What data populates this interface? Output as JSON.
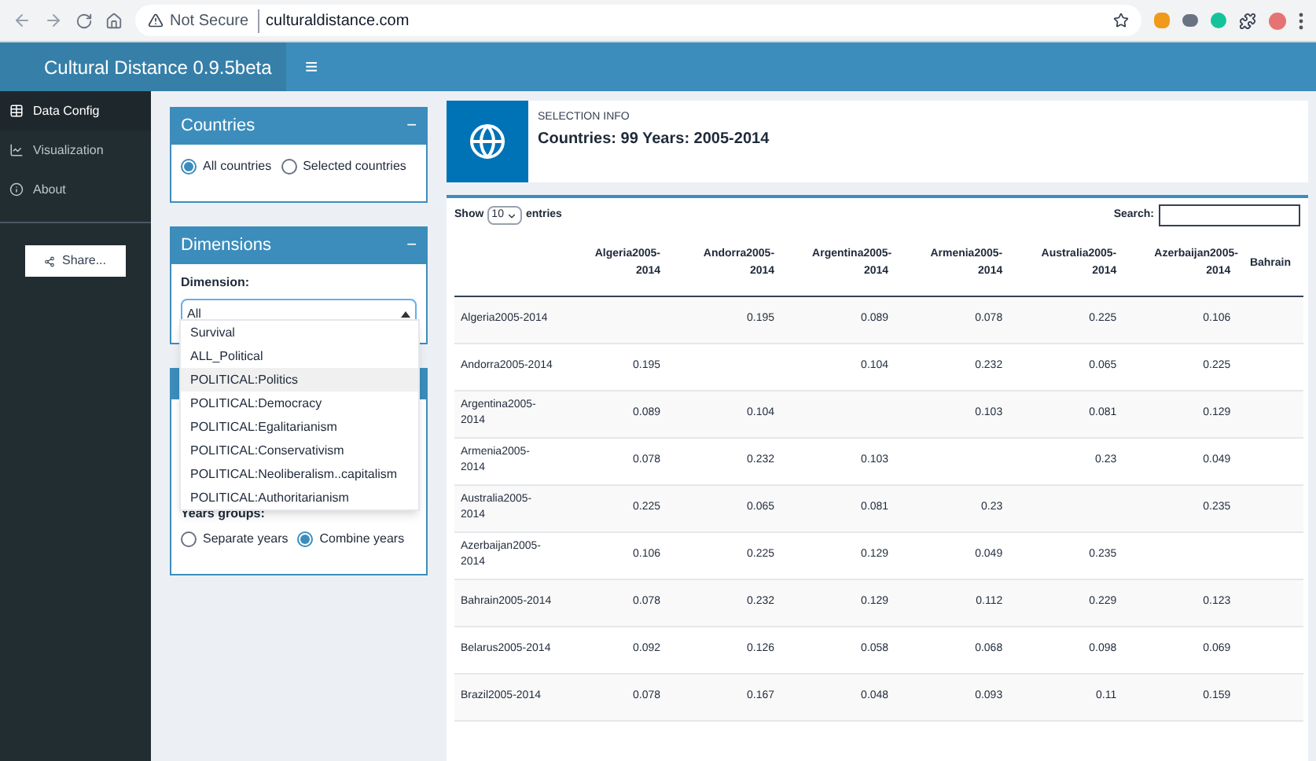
{
  "browser": {
    "security": "Not Secure",
    "url": "culturaldistance.com"
  },
  "header": {
    "title": "Cultural Distance 0.9.5beta",
    "menu_icon": "≡"
  },
  "sidebar": {
    "items": [
      {
        "label": "Data Config",
        "selected": true
      },
      {
        "label": "Visualization",
        "selected": false
      },
      {
        "label": "About",
        "selected": false
      }
    ],
    "share_button": "Share..."
  },
  "countries_panel": {
    "title": "Countries",
    "collapse": "−",
    "options": [
      {
        "label": "All countries",
        "selected": true
      },
      {
        "label": "Selected countries",
        "selected": false
      }
    ]
  },
  "dimensions_panel": {
    "title": "Dimensions",
    "collapse": "−",
    "label": "Dimension:",
    "value": "All",
    "dropdown": [
      {
        "label": "Survival",
        "selected": false
      },
      {
        "label": "ALL_Political",
        "selected": false
      },
      {
        "label": "POLITICAL:Politics",
        "selected": true
      },
      {
        "label": "POLITICAL:Democracy",
        "selected": false
      },
      {
        "label": "POLITICAL:Egalitarianism",
        "selected": false
      },
      {
        "label": "POLITICAL:Conservativism",
        "selected": false
      },
      {
        "label": "POLITICAL:Neoliberalism..capitalism",
        "selected": false
      },
      {
        "label": "POLITICAL:Authoritarianism",
        "selected": false
      }
    ]
  },
  "years_panel": {
    "label": "Years groups:",
    "options": [
      {
        "label": "Separate years",
        "selected": false
      },
      {
        "label": "Combine years",
        "selected": true
      }
    ]
  },
  "info_box": {
    "label": "SELECTION INFO",
    "value": "Countries: 99 Years: 2005-2014"
  },
  "table": {
    "show_label": "Show",
    "page_size": "10",
    "entries_label": "entries",
    "search_label": "Search:",
    "columns": [
      "Algeria2005-2014",
      "Andorra2005-2014",
      "Argentina2005-2014",
      "Armenia2005-2014",
      "Australia2005-2014",
      "Azerbaijan2005-2014",
      "Bahrain"
    ],
    "rows": [
      {
        "name": "Algeria2005-2014",
        "values": [
          "0.195",
          "0.089",
          "0.078",
          "0.225",
          "0.106"
        ]
      },
      {
        "name": "Andorra2005-2014",
        "values": [
          "0.195",
          "0.104",
          "0.232",
          "0.065",
          "0.225"
        ]
      },
      {
        "name": "Argentina2005-2014",
        "values": [
          "0.089",
          "0.104",
          "0.103",
          "0.081",
          "0.129"
        ]
      },
      {
        "name": "Armenia2005-2014",
        "values": [
          "0.078",
          "0.232",
          "0.103",
          "0.23",
          "0.049"
        ]
      },
      {
        "name": "Australia2005-2014",
        "values": [
          "0.225",
          "0.065",
          "0.081",
          "0.23",
          "0.235"
        ]
      },
      {
        "name": "Azerbaijan2005-2014",
        "values": [
          "0.106",
          "0.225",
          "0.129",
          "0.049",
          "0.235"
        ]
      },
      {
        "name": "Bahrain2005-2014",
        "values": [
          "0.078",
          "0.232",
          "0.129",
          "0.112",
          "0.229",
          "0.123"
        ]
      },
      {
        "name": "Belarus2005-2014",
        "values": [
          "0.092",
          "0.126",
          "0.058",
          "0.068",
          "0.098",
          "0.069"
        ]
      },
      {
        "name": "Brazil2005-2014",
        "values": [
          "0.078",
          "0.167",
          "0.048",
          "0.093",
          "0.11",
          "0.159"
        ]
      }
    ]
  }
}
